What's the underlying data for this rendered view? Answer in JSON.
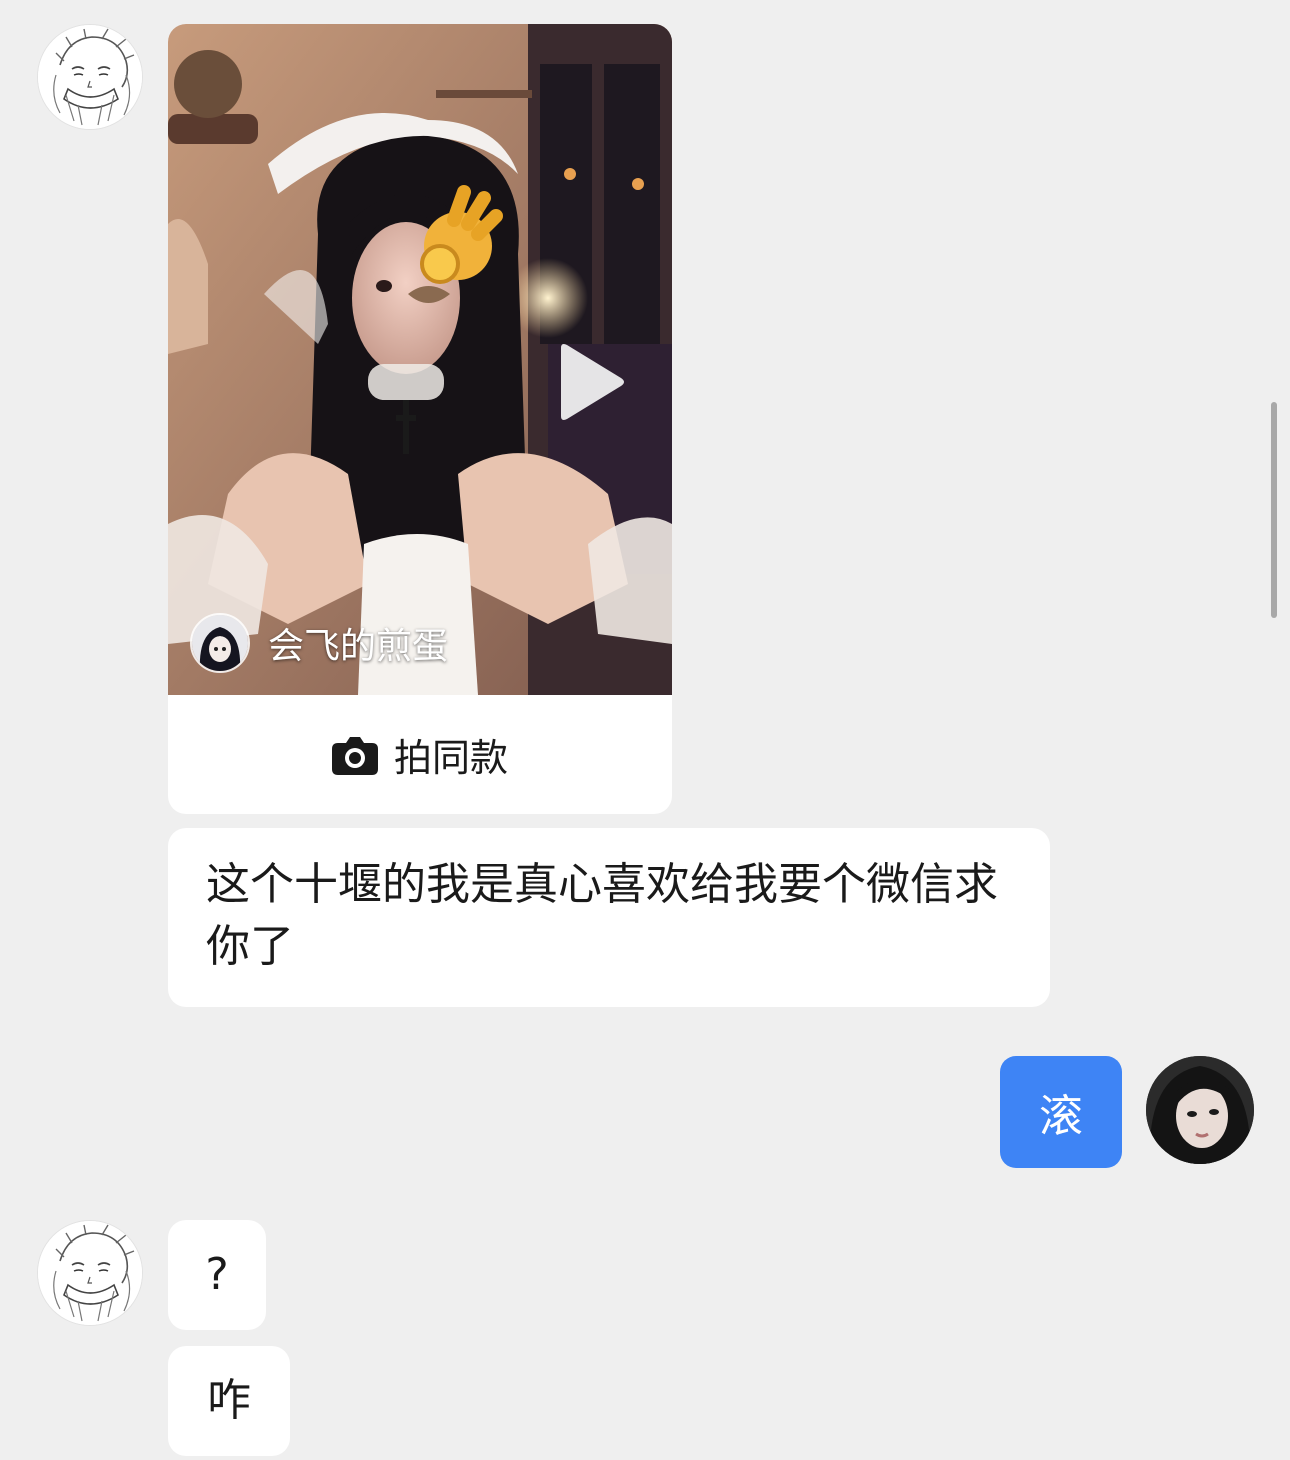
{
  "messages": {
    "video_card": {
      "author_name": "会飞的煎蛋",
      "action_label": "拍同款",
      "action_icon": "camera-icon",
      "play_icon": "play-icon"
    },
    "received_1": "这个十堰的我是真心喜欢给我要个微信求你了",
    "sent_1": "滚",
    "received_2": "?",
    "received_3": "咋"
  },
  "colors": {
    "background": "#efefef",
    "bubble_received": "#ffffff",
    "bubble_sent": "#3e84f5"
  }
}
